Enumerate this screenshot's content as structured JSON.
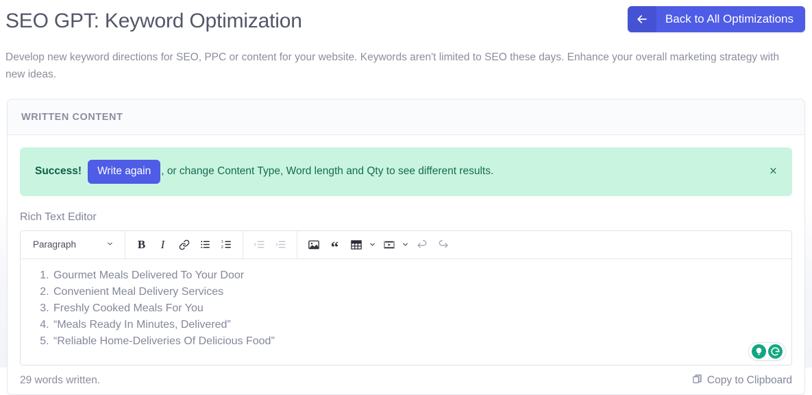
{
  "header": {
    "title": "SEO GPT: Keyword Optimization",
    "back_button": {
      "label": "Back to All Optimizations",
      "icon": "arrow-left-icon"
    }
  },
  "description": "Develop new keyword directions for SEO, PPC or content for your website. Keywords aren't limited to SEO these days. Enhance your overall marketing strategy with new ideas.",
  "card": {
    "header_title": "WRITTEN CONTENT"
  },
  "alert": {
    "type": "success",
    "strong_label": "Success!",
    "action_button": "Write again",
    "message": ", or change Content Type, Word length and Qty to see different results.",
    "close_label": "×",
    "background_color": "#c9f5e0",
    "text_color": "#166b51",
    "button_color": "#4e5ce6"
  },
  "editor": {
    "label": "Rich Text Editor",
    "toolbar": {
      "block_format": "Paragraph",
      "buttons": [
        {
          "name": "bold-icon",
          "glyph": "B",
          "disabled": false
        },
        {
          "name": "italic-icon",
          "glyph": "I",
          "disabled": false
        },
        {
          "name": "link-icon",
          "glyph": "link",
          "disabled": false
        },
        {
          "name": "bullet-list-icon",
          "glyph": "ul",
          "disabled": false
        },
        {
          "name": "numbered-list-icon",
          "glyph": "ol",
          "disabled": false
        },
        {
          "name": "indent-icon",
          "glyph": "indent",
          "disabled": true
        },
        {
          "name": "outdent-icon",
          "glyph": "outdent",
          "disabled": true
        },
        {
          "name": "image-icon",
          "glyph": "image",
          "disabled": false
        },
        {
          "name": "blockquote-icon",
          "glyph": "“",
          "disabled": false
        },
        {
          "name": "table-icon",
          "glyph": "table",
          "disabled": false
        },
        {
          "name": "media-icon",
          "glyph": "media",
          "disabled": false
        },
        {
          "name": "undo-icon",
          "glyph": "undo",
          "disabled": false
        },
        {
          "name": "redo-icon",
          "glyph": "redo",
          "disabled": false
        }
      ]
    },
    "content_items": [
      "Gourmet Meals Delivered To Your Door",
      "Convenient Meal Delivery Services",
      "Freshly Cooked Meals For You",
      "“Meals Ready In Minutes, Delivered”",
      "“Reliable Home-Deliveries Of Delicious Food”"
    ],
    "grammarly_widget": {
      "bulb_icon": "lightbulb-icon",
      "logo_icon": "grammarly-logo-icon",
      "color": "#15a881"
    }
  },
  "footer": {
    "word_count": "29 words written.",
    "copy_label": "Copy to Clipboard",
    "copy_icon": "copy-icon"
  }
}
